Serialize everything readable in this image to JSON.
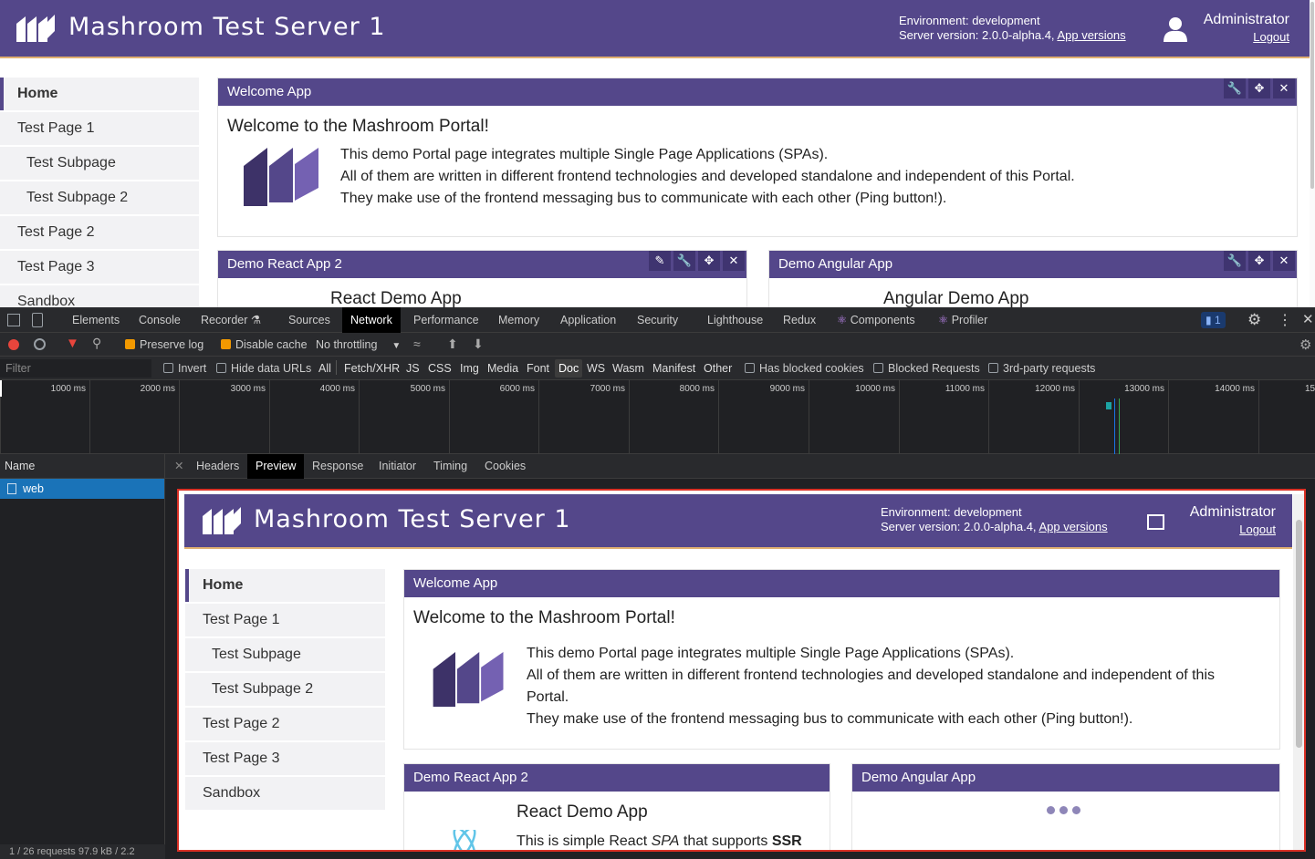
{
  "portal": {
    "title": "Mashroom Test Server 1",
    "environment": "Environment: development",
    "server_version": "Server version: 2.0.0-alpha.4,",
    "app_versions": "App versions",
    "user": "Administrator",
    "logout": "Logout",
    "nav": [
      {
        "label": "Home"
      },
      {
        "label": "Test Page 1"
      },
      {
        "label": "Test Subpage"
      },
      {
        "label": "Test Subpage 2"
      },
      {
        "label": "Test Page 2"
      },
      {
        "label": "Test Page 3"
      },
      {
        "label": "Sandbox"
      }
    ],
    "welcome_app": {
      "title": "Welcome App",
      "heading": "Welcome to the Mashroom Portal!",
      "line1": "This demo Portal page integrates multiple Single Page Applications (SPAs).",
      "line2": "All of them are written in different frontend technologies and developed standalone and independent of this Portal.",
      "line3": "They make use of the frontend messaging bus to communicate with each other (Ping button!).",
      "line2_wrapped_a": "All of them are written in different frontend technologies and developed standalone and independent of this",
      "line2_wrapped_b": "Portal."
    },
    "react_app": {
      "title": "Demo React App 2",
      "heading": "React Demo App",
      "text_a": "This is simple React ",
      "text_spa": "SPA",
      "text_b": " that supports ",
      "text_ssr": "SSR"
    },
    "angular_app": {
      "title": "Demo Angular App",
      "heading": "Angular Demo App"
    },
    "colors": {
      "header": "#54478a",
      "accent": "#e0b070"
    }
  },
  "devtools": {
    "tabs": [
      "Elements",
      "Console",
      "Recorder ⚗",
      "Sources",
      "Network",
      "Performance",
      "Memory",
      "Application",
      "Security",
      "Lighthouse",
      "Redux",
      "Components",
      "Profiler"
    ],
    "active_tab": "Network",
    "issues_badge": "1",
    "toolbar": {
      "preserve_log": "Preserve log",
      "disable_cache": "Disable cache",
      "throttling": "No throttling"
    },
    "filter": {
      "placeholder": "Filter",
      "invert": "Invert",
      "hide_data_urls": "Hide data URLs",
      "types": [
        "All",
        "Fetch/XHR",
        "JS",
        "CSS",
        "Img",
        "Media",
        "Font",
        "Doc",
        "WS",
        "Wasm",
        "Manifest",
        "Other"
      ],
      "active_type": "Doc",
      "has_blocked_cookies": "Has blocked cookies",
      "blocked_requests": "Blocked Requests",
      "third_party": "3rd-party requests"
    },
    "timeline_ticks": [
      "1000 ms",
      "2000 ms",
      "3000 ms",
      "4000 ms",
      "5000 ms",
      "6000 ms",
      "7000 ms",
      "8000 ms",
      "9000 ms",
      "10000 ms",
      "11000 ms",
      "12000 ms",
      "13000 ms",
      "14000 ms",
      "15"
    ],
    "requests": {
      "header": "Name",
      "rows": [
        {
          "name": "web"
        }
      ]
    },
    "status": "1 / 26 requests   97.9 kB / 2.2",
    "detail_tabs": [
      "Headers",
      "Preview",
      "Response",
      "Initiator",
      "Timing",
      "Cookies"
    ],
    "active_detail_tab": "Preview"
  }
}
